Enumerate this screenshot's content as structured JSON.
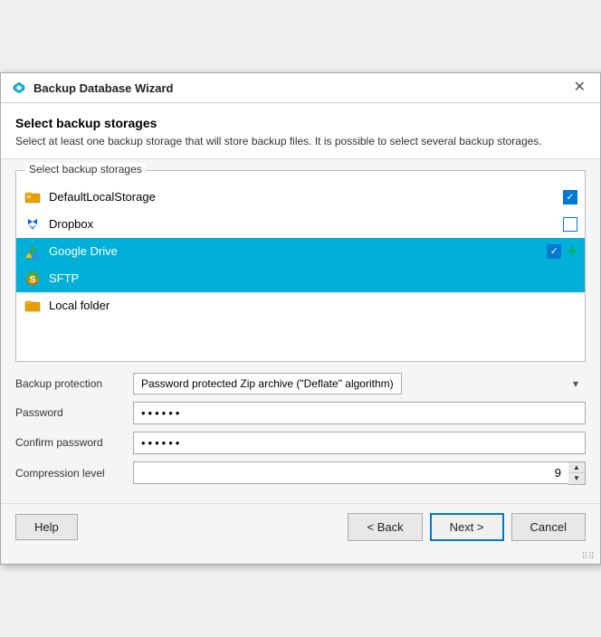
{
  "titleBar": {
    "title": "Backup Database Wizard",
    "closeLabel": "✕"
  },
  "header": {
    "title": "Select backup storages",
    "description": "Select at least one backup storage that will store backup files. It is possible to select several backup storages."
  },
  "storageGroup": {
    "label": "Select backup storages",
    "items": [
      {
        "name": "DefaultLocalStorage",
        "icon": "local",
        "checked": true,
        "selected": false,
        "hasCheckbox": true
      },
      {
        "name": "Dropbox",
        "icon": "dropbox",
        "checked": false,
        "selected": false,
        "hasCheckbox": true
      },
      {
        "name": "Google Drive",
        "icon": "gdrive",
        "checked": true,
        "selected": true,
        "hasCheckbox": true,
        "hasAdd": true
      },
      {
        "name": "SFTP",
        "icon": "sftp",
        "checked": false,
        "selected": true,
        "hasCheckbox": false
      },
      {
        "name": "Local folder",
        "icon": "local2",
        "checked": false,
        "selected": false,
        "hasCheckbox": false
      }
    ]
  },
  "form": {
    "backupProtection": {
      "label": "Backup protection",
      "value": "Password protected Zip archive (\"Deflate\" algorithm)"
    },
    "password": {
      "label": "Password",
      "value": "••••••"
    },
    "confirmPassword": {
      "label": "Confirm password",
      "value": "••••••"
    },
    "compressionLevel": {
      "label": "Compression level",
      "value": "9"
    }
  },
  "footer": {
    "helpLabel": "Help",
    "backLabel": "< Back",
    "nextLabel": "Next >",
    "cancelLabel": "Cancel"
  },
  "bottomDots": "⠿⠿"
}
